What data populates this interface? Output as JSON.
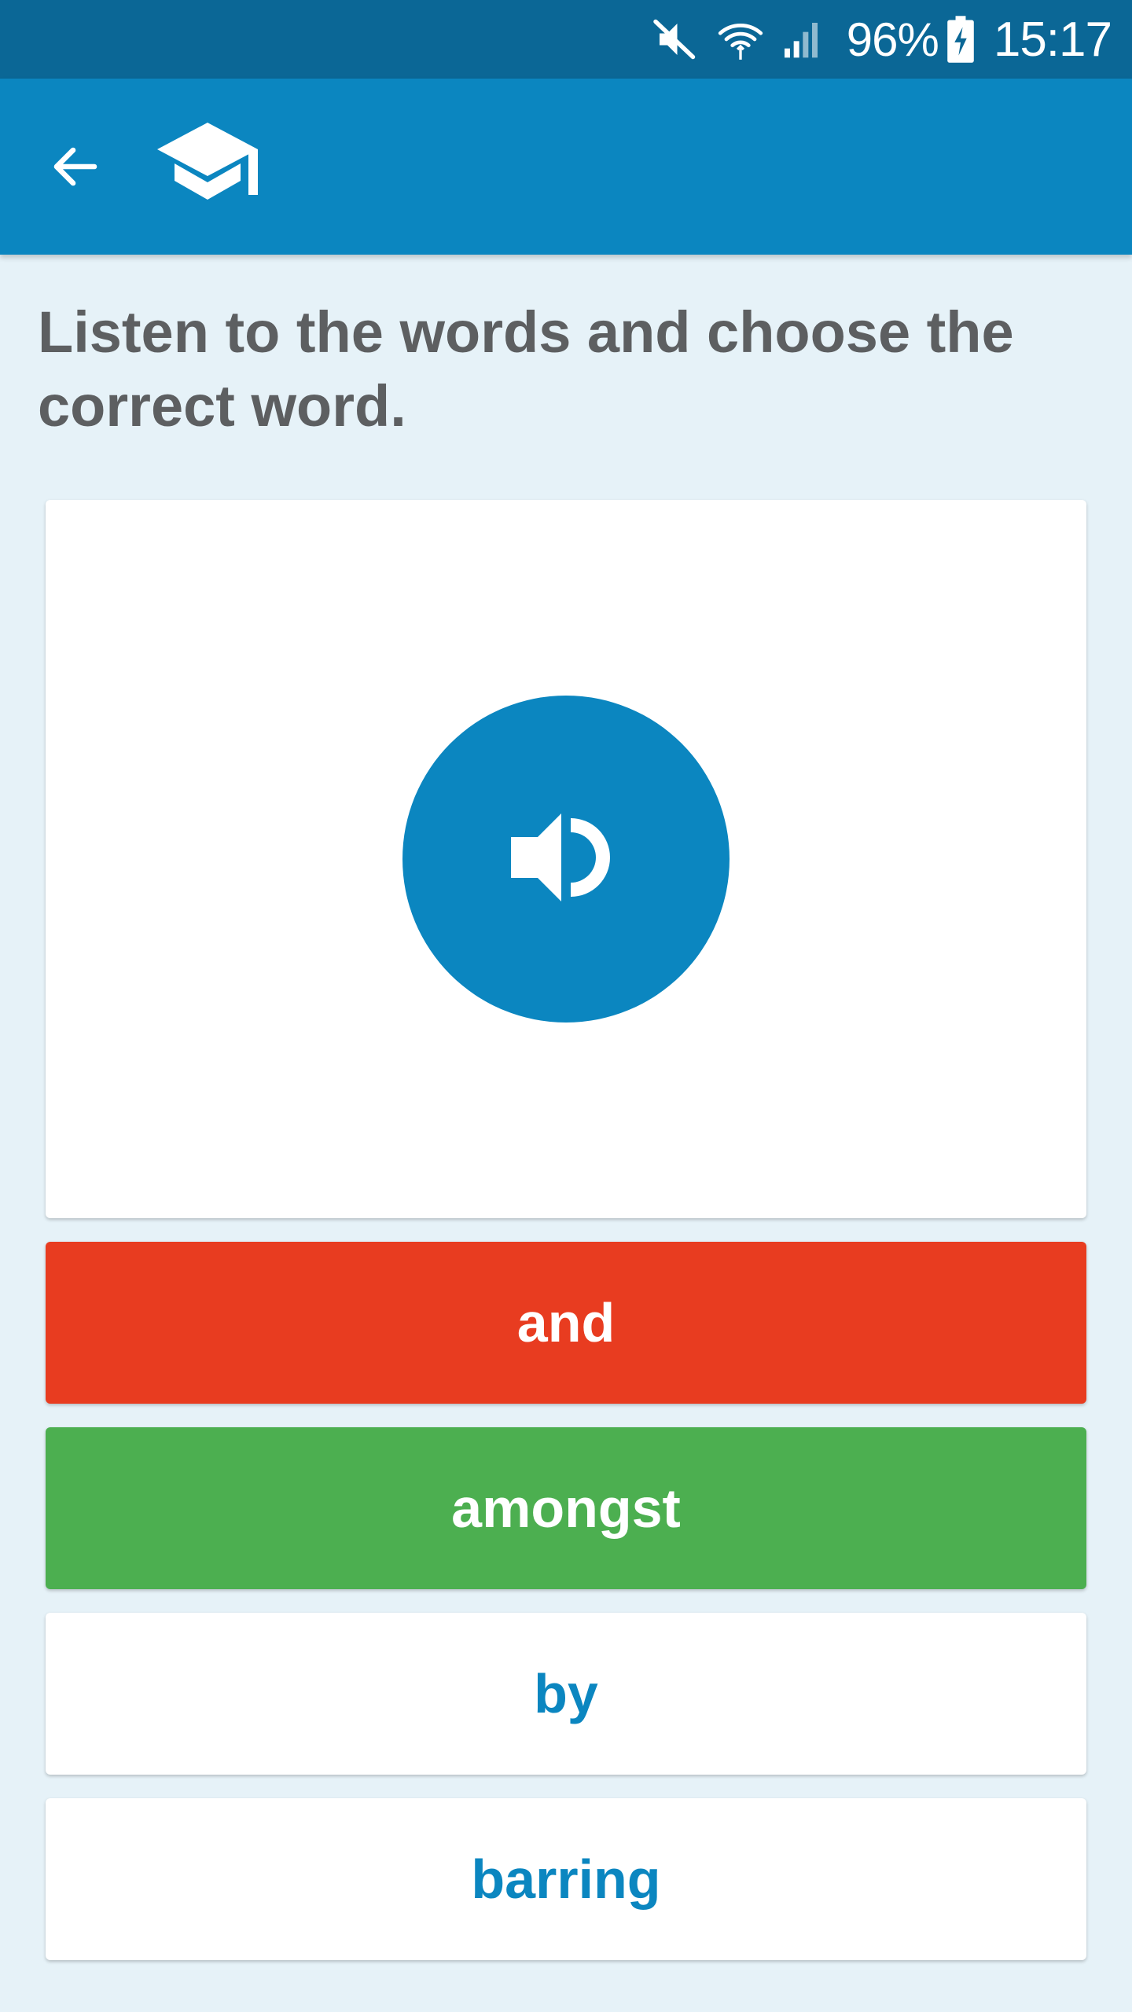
{
  "status_bar": {
    "battery_percent": "96%",
    "time": "15:17",
    "icons": [
      "mute-icon",
      "wifi-icon",
      "cellular-signal-icon",
      "battery-charging-icon"
    ]
  },
  "app_bar": {
    "back_icon": "arrow-left-icon",
    "logo_icon": "graduation-cap-icon",
    "background_color": "#0b86c0"
  },
  "quiz": {
    "instruction": "Listen to the words and choose the correct word.",
    "audio_icon": "speaker-volume-icon",
    "options": [
      {
        "label": "and",
        "state": "incorrect",
        "bg": "#e83c20",
        "fg": "#ffffff"
      },
      {
        "label": "amongst",
        "state": "correct",
        "bg": "#4caf50",
        "fg": "#ffffff"
      },
      {
        "label": "by",
        "state": "neutral",
        "bg": "#ffffff",
        "fg": "#0b86c0"
      },
      {
        "label": "barring",
        "state": "neutral",
        "bg": "#ffffff",
        "fg": "#0b86c0"
      }
    ]
  },
  "colors": {
    "status_bar": "#0b6796",
    "app_bar": "#0b86c0",
    "page_background": "#e6f2f8",
    "instruction_text": "#5d5f61",
    "accent": "#0b86c0",
    "incorrect": "#e83c20",
    "correct": "#4caf50"
  }
}
